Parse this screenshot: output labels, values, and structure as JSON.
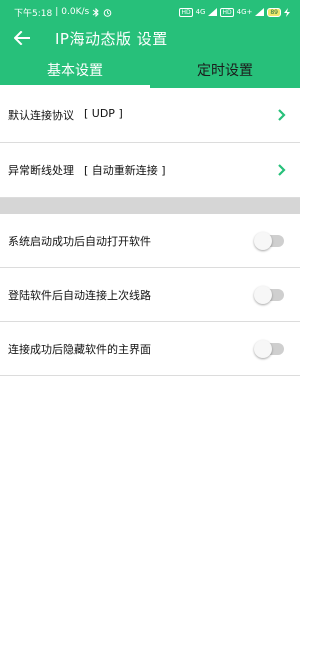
{
  "status_bar": {
    "time": "下午5:18",
    "speed": "0.0K/s",
    "sim1": "HD",
    "sim1_signal": "4G",
    "sim2": "HD",
    "sim2_signal": "4G+",
    "battery": "89"
  },
  "header": {
    "title": "IP海动态版 设置"
  },
  "tabs": [
    {
      "label": "基本设置",
      "active": true
    },
    {
      "label": "定时设置",
      "active": false
    }
  ],
  "settings": {
    "protocol": {
      "label": "默认连接协议",
      "value": "[ UDP ]"
    },
    "disconnect": {
      "label": "异常断线处理",
      "value": "[ 自动重新连接 ]"
    },
    "toggles": [
      {
        "label": "系统启动成功后自动打开软件",
        "on": false
      },
      {
        "label": "登陆软件后自动连接上次线路",
        "on": false
      },
      {
        "label": "连接成功后隐藏软件的主界面",
        "on": false
      }
    ]
  },
  "colors": {
    "primary": "#27c07a",
    "chevron": "#27c07a",
    "toggle_off": "#cfcfcf"
  }
}
